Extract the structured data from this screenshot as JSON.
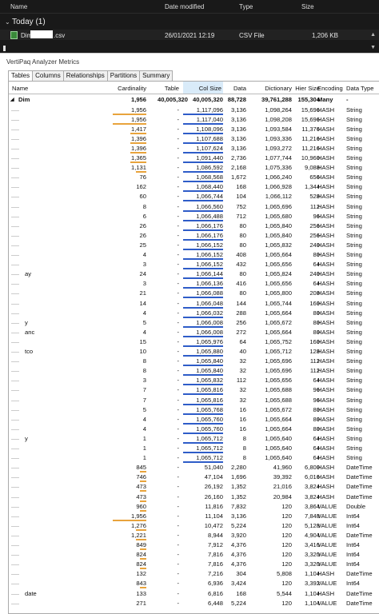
{
  "explorer": {
    "headers": [
      "Name",
      "Date modified",
      "Type",
      "Size"
    ],
    "group": "Today (1)",
    "file": {
      "name_prefix": "Dim",
      "name_suffix": ".csv",
      "date": "26/01/2021 12:19",
      "type": "CSV File",
      "size": "1,206 KB"
    }
  },
  "analyzer": {
    "title": "VertiPaq Analyzer Metrics",
    "tabs": [
      "Tables",
      "Columns",
      "Relationships",
      "Partitions",
      "Summary"
    ],
    "columns": [
      "Name",
      "Cardinality",
      "Table",
      "Col Size",
      "Data",
      "Dictionary",
      "Hier Size",
      "Encoding",
      "Data Type"
    ],
    "total": {
      "name": "Dim",
      "cardinality": "1,956",
      "table": "40,005,320",
      "colsize": "40,005,320",
      "data": "88,728",
      "dict": "39,761,288",
      "hier": "155,304",
      "enc": "Many",
      "type": "-"
    },
    "colors": {
      "cardinality_bar": "#e8a33c",
      "colsize_bar": "#2e5cc8"
    },
    "rows": [
      {
        "name": "",
        "card": "1,956",
        "t": "-",
        "cs": "1,117,096",
        "d": "3,136",
        "dic": "1,098,264",
        "h": "15,696",
        "e": "HASH",
        "dt": "String",
        "cb": 0.95
      },
      {
        "name": "",
        "card": "1,956",
        "t": "-",
        "cs": "1,117,040",
        "d": "3,136",
        "dic": "1,098,208",
        "h": "15,696",
        "e": "HASH",
        "dt": "String",
        "cb": 0.95
      },
      {
        "name": "",
        "card": "1,417",
        "t": "-",
        "cs": "1,108,096",
        "d": "3,136",
        "dic": "1,093,584",
        "h": "11,376",
        "e": "HASH",
        "dt": "String",
        "cb": 0.45
      },
      {
        "name": "",
        "card": "1,396",
        "t": "-",
        "cs": "1,107,688",
        "d": "3,136",
        "dic": "1,093,336",
        "h": "11,216",
        "e": "HASH",
        "dt": "String",
        "cb": 0.45
      },
      {
        "name": "",
        "card": "1,396",
        "t": "-",
        "cs": "1,107,624",
        "d": "3,136",
        "dic": "1,093,272",
        "h": "11,216",
        "e": "HASH",
        "dt": "String",
        "cb": 0.45
      },
      {
        "name": "",
        "card": "1,365",
        "t": "-",
        "cs": "1,091,440",
        "d": "2,736",
        "dic": "1,077,744",
        "h": "10,960",
        "e": "HASH",
        "dt": "String",
        "cb": 0.45
      },
      {
        "name": "",
        "card": "1,131",
        "t": "-",
        "cs": "1,086,592",
        "d": "2,168",
        "dic": "1,075,336",
        "h": "9,088",
        "e": "HASH",
        "dt": "String",
        "cb": 0.3
      },
      {
        "name": "",
        "card": "76",
        "t": "-",
        "cs": "1,068,568",
        "d": "1,672",
        "dic": "1,066,240",
        "h": "656",
        "e": "HASH",
        "dt": "String",
        "cb": 0
      },
      {
        "name": "",
        "card": "162",
        "t": "-",
        "cs": "1,068,440",
        "d": "168",
        "dic": "1,066,928",
        "h": "1,344",
        "e": "HASH",
        "dt": "String",
        "cb": 0
      },
      {
        "name": "",
        "card": "60",
        "t": "-",
        "cs": "1,066,744",
        "d": "104",
        "dic": "1,066,112",
        "h": "528",
        "e": "HASH",
        "dt": "String",
        "cb": 0
      },
      {
        "name": "",
        "card": "8",
        "t": "-",
        "cs": "1,066,560",
        "d": "752",
        "dic": "1,065,696",
        "h": "112",
        "e": "HASH",
        "dt": "String",
        "cb": 0
      },
      {
        "name": "",
        "card": "6",
        "t": "-",
        "cs": "1,066,488",
        "d": "712",
        "dic": "1,065,680",
        "h": "96",
        "e": "HASH",
        "dt": "String",
        "cb": 0
      },
      {
        "name": "",
        "card": "26",
        "t": "-",
        "cs": "1,066,176",
        "d": "80",
        "dic": "1,065,840",
        "h": "256",
        "e": "HASH",
        "dt": "String",
        "cb": 0
      },
      {
        "name": "",
        "card": "26",
        "t": "-",
        "cs": "1,066,176",
        "d": "80",
        "dic": "1,065,840",
        "h": "256",
        "e": "HASH",
        "dt": "String",
        "cb": 0
      },
      {
        "name": "",
        "card": "25",
        "t": "-",
        "cs": "1,066,152",
        "d": "80",
        "dic": "1,065,832",
        "h": "240",
        "e": "HASH",
        "dt": "String",
        "cb": 0
      },
      {
        "name": "",
        "card": "4",
        "t": "-",
        "cs": "1,066,152",
        "d": "408",
        "dic": "1,065,664",
        "h": "80",
        "e": "HASH",
        "dt": "String",
        "cb": 0
      },
      {
        "name": "",
        "card": "3",
        "t": "-",
        "cs": "1,066,152",
        "d": "432",
        "dic": "1,065,656",
        "h": "64",
        "e": "HASH",
        "dt": "String",
        "cb": 0
      },
      {
        "name": "ay",
        "card": "24",
        "t": "-",
        "cs": "1,066,144",
        "d": "80",
        "dic": "1,065,824",
        "h": "240",
        "e": "HASH",
        "dt": "String",
        "cb": 0
      },
      {
        "name": "",
        "card": "3",
        "t": "-",
        "cs": "1,066,136",
        "d": "416",
        "dic": "1,065,656",
        "h": "64",
        "e": "HASH",
        "dt": "String",
        "cb": 0
      },
      {
        "name": "",
        "card": "21",
        "t": "-",
        "cs": "1,066,088",
        "d": "80",
        "dic": "1,065,800",
        "h": "208",
        "e": "HASH",
        "dt": "String",
        "cb": 0
      },
      {
        "name": "",
        "card": "14",
        "t": "-",
        "cs": "1,066,048",
        "d": "144",
        "dic": "1,065,744",
        "h": "160",
        "e": "HASH",
        "dt": "String",
        "cb": 0
      },
      {
        "name": "",
        "card": "4",
        "t": "-",
        "cs": "1,066,032",
        "d": "288",
        "dic": "1,065,664",
        "h": "80",
        "e": "HASH",
        "dt": "String",
        "cb": 0
      },
      {
        "name": "y",
        "card": "5",
        "t": "-",
        "cs": "1,066,008",
        "d": "256",
        "dic": "1,065,672",
        "h": "80",
        "e": "HASH",
        "dt": "String",
        "cb": 0
      },
      {
        "name": "anc",
        "card": "4",
        "t": "-",
        "cs": "1,066,008",
        "d": "272",
        "dic": "1,065,664",
        "h": "80",
        "e": "HASH",
        "dt": "String",
        "cb": 0
      },
      {
        "name": "",
        "card": "15",
        "t": "-",
        "cs": "1,065,976",
        "d": "64",
        "dic": "1,065,752",
        "h": "160",
        "e": "HASH",
        "dt": "String",
        "cb": 0
      },
      {
        "name": "tco",
        "card": "10",
        "t": "-",
        "cs": "1,065,880",
        "d": "40",
        "dic": "1,065,712",
        "h": "128",
        "e": "HASH",
        "dt": "String",
        "cb": 0
      },
      {
        "name": "",
        "card": "8",
        "t": "-",
        "cs": "1,065,840",
        "d": "32",
        "dic": "1,065,696",
        "h": "112",
        "e": "HASH",
        "dt": "String",
        "cb": 0
      },
      {
        "name": "",
        "card": "8",
        "t": "-",
        "cs": "1,065,840",
        "d": "32",
        "dic": "1,065,696",
        "h": "112",
        "e": "HASH",
        "dt": "String",
        "cb": 0
      },
      {
        "name": "",
        "card": "3",
        "t": "-",
        "cs": "1,065,832",
        "d": "112",
        "dic": "1,065,656",
        "h": "64",
        "e": "HASH",
        "dt": "String",
        "cb": 0
      },
      {
        "name": "",
        "card": "7",
        "t": "-",
        "cs": "1,065,816",
        "d": "32",
        "dic": "1,065,688",
        "h": "96",
        "e": "HASH",
        "dt": "String",
        "cb": 0
      },
      {
        "name": "",
        "card": "7",
        "t": "-",
        "cs": "1,065,816",
        "d": "32",
        "dic": "1,065,688",
        "h": "96",
        "e": "HASH",
        "dt": "String",
        "cb": 0
      },
      {
        "name": "",
        "card": "5",
        "t": "-",
        "cs": "1,065,768",
        "d": "16",
        "dic": "1,065,672",
        "h": "80",
        "e": "HASH",
        "dt": "String",
        "cb": 0
      },
      {
        "name": "",
        "card": "4",
        "t": "-",
        "cs": "1,065,760",
        "d": "16",
        "dic": "1,065,664",
        "h": "80",
        "e": "HASH",
        "dt": "String",
        "cb": 0
      },
      {
        "name": "",
        "card": "4",
        "t": "-",
        "cs": "1,065,760",
        "d": "16",
        "dic": "1,065,664",
        "h": "80",
        "e": "HASH",
        "dt": "String",
        "cb": 0
      },
      {
        "name": "y",
        "card": "1",
        "t": "-",
        "cs": "1,065,712",
        "d": "8",
        "dic": "1,065,640",
        "h": "64",
        "e": "HASH",
        "dt": "String",
        "cb": 0
      },
      {
        "name": "",
        "card": "1",
        "t": "-",
        "cs": "1,065,712",
        "d": "8",
        "dic": "1,065,640",
        "h": "64",
        "e": "HASH",
        "dt": "String",
        "cb": 0
      },
      {
        "name": "",
        "card": "1",
        "t": "-",
        "cs": "1,065,712",
        "d": "8",
        "dic": "1,065,640",
        "h": "64",
        "e": "HASH",
        "dt": "String",
        "cb": 0
      },
      {
        "name": "",
        "card": "845",
        "t": "-",
        "cs": "51,040",
        "d": "2,280",
        "dic": "41,960",
        "h": "6,800",
        "e": "HASH",
        "dt": "DateTime",
        "cb": 0.15
      },
      {
        "name": "",
        "card": "746",
        "t": "-",
        "cs": "47,104",
        "d": "1,696",
        "dic": "39,392",
        "h": "6,016",
        "e": "HASH",
        "dt": "DateTime",
        "cb": 0.15
      },
      {
        "name": "",
        "card": "473",
        "t": "-",
        "cs": "26,192",
        "d": "1,352",
        "dic": "21,016",
        "h": "3,824",
        "e": "HASH",
        "dt": "DateTime",
        "cb": 0.1
      },
      {
        "name": "",
        "card": "473",
        "t": "-",
        "cs": "26,160",
        "d": "1,352",
        "dic": "20,984",
        "h": "3,824",
        "e": "HASH",
        "dt": "DateTime",
        "cb": 0.1
      },
      {
        "name": "",
        "card": "960",
        "t": "-",
        "cs": "11,816",
        "d": "7,832",
        "dic": "120",
        "h": "3,864",
        "e": "VALUE",
        "dt": "Double",
        "cb": 0.15
      },
      {
        "name": "",
        "card": "1,956",
        "t": "-",
        "cs": "11,104",
        "d": "3,136",
        "dic": "120",
        "h": "7,848",
        "e": "VALUE",
        "dt": "Int64",
        "cb": 0.95
      },
      {
        "name": "",
        "card": "1,276",
        "t": "-",
        "cs": "10,472",
        "d": "5,224",
        "dic": "120",
        "h": "5,128",
        "e": "VALUE",
        "dt": "Int64",
        "cb": 0.3
      },
      {
        "name": "",
        "card": "1,221",
        "t": "-",
        "cs": "8,944",
        "d": "3,920",
        "dic": "120",
        "h": "4,904",
        "e": "VALUE",
        "dt": "DateTime",
        "cb": 0.3
      },
      {
        "name": "",
        "card": "849",
        "t": "-",
        "cs": "7,912",
        "d": "4,376",
        "dic": "120",
        "h": "3,416",
        "e": "VALUE",
        "dt": "Int64",
        "cb": 0.15
      },
      {
        "name": "",
        "card": "824",
        "t": "-",
        "cs": "7,816",
        "d": "4,376",
        "dic": "120",
        "h": "3,320",
        "e": "VALUE",
        "dt": "Int64",
        "cb": 0.15
      },
      {
        "name": "",
        "card": "824",
        "t": "-",
        "cs": "7,816",
        "d": "4,376",
        "dic": "120",
        "h": "3,320",
        "e": "VALUE",
        "dt": "Int64",
        "cb": 0.15
      },
      {
        "name": "",
        "card": "132",
        "t": "-",
        "cs": "7,216",
        "d": "304",
        "dic": "5,808",
        "h": "1,104",
        "e": "HASH",
        "dt": "DateTime",
        "cb": 0
      },
      {
        "name": "",
        "card": "843",
        "t": "-",
        "cs": "6,936",
        "d": "3,424",
        "dic": "120",
        "h": "3,392",
        "e": "VALUE",
        "dt": "Int64",
        "cb": 0.15
      },
      {
        "name": "date",
        "card": "133",
        "t": "-",
        "cs": "6,816",
        "d": "168",
        "dic": "5,544",
        "h": "1,104",
        "e": "HASH",
        "dt": "DateTime",
        "cb": 0
      },
      {
        "name": "",
        "card": "271",
        "t": "-",
        "cs": "6,448",
        "d": "5,224",
        "dic": "120",
        "h": "1,104",
        "e": "VALUE",
        "dt": "DateTime",
        "cb": 0
      }
    ]
  }
}
